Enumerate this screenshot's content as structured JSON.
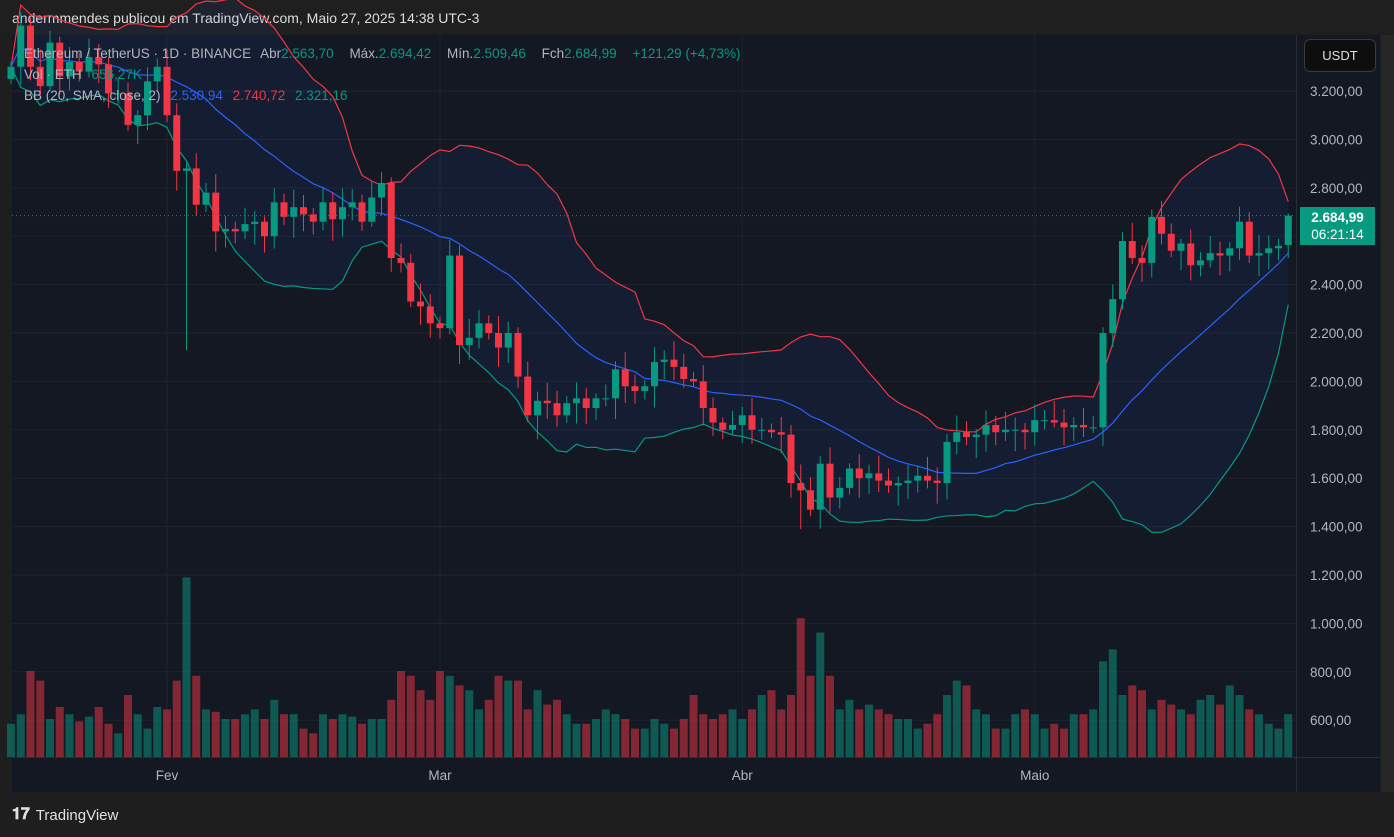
{
  "header": {
    "publisher": "andermmendes publicou em TradingView.com, Maio 27, 2025 14:38 UTC-3"
  },
  "legend": {
    "symbol": "Ethereum / TetherUS · 1D · BINANCE",
    "open_label": "Abr",
    "open": "2.563,70",
    "high_label": "Máx.",
    "high": "2.694,42",
    "low_label": "Mín.",
    "low": "2.509,46",
    "close_label": "Fch",
    "close": "2.684,99",
    "change": "+121,29 (+4,73%)",
    "volume_label": "Vol · ETH",
    "volume": "656,27K",
    "bb_label": "BB (20, SMA, close, 2)",
    "bb_basis": "2.530,94",
    "bb_upper": "2.740,72",
    "bb_lower": "2.321,16"
  },
  "currency": "USDT",
  "last_price": {
    "price": "2.684,99",
    "countdown": "06:21:14"
  },
  "footer": {
    "brand": "TradingView",
    "logo": "17"
  },
  "colors": {
    "up": "#089981",
    "down": "#f23645",
    "basis": "#2962ff",
    "upper": "#f23645",
    "lower": "#089981"
  },
  "chart_data": {
    "type": "candlestick",
    "title": "Ethereum / TetherUS · 1D · BINANCE",
    "start_date": "2025-01-16",
    "end_date": "2025-05-27",
    "first_open": 3250,
    "close": [
      3300,
      3470,
      3300,
      3220,
      3400,
      3260,
      3320,
      3280,
      3340,
      3310,
      3190,
      3190,
      3060,
      3100,
      3240,
      3300,
      3100,
      2870,
      2880,
      2730,
      2780,
      2620,
      2630,
      2620,
      2650,
      2660,
      2600,
      2740,
      2680,
      2720,
      2690,
      2660,
      2740,
      2670,
      2720,
      2740,
      2660,
      2760,
      2820,
      2510,
      2490,
      2330,
      2310,
      2240,
      2220,
      2520,
      2150,
      2180,
      2240,
      2200,
      2140,
      2200,
      2020,
      1860,
      1920,
      1910,
      1860,
      1910,
      1930,
      1890,
      1930,
      1930,
      2050,
      1980,
      1960,
      1980,
      2080,
      2090,
      2060,
      2010,
      2000,
      1890,
      1830,
      1800,
      1820,
      1860,
      1800,
      1800,
      1790,
      1780,
      1580,
      1550,
      1470,
      1660,
      1520,
      1560,
      1640,
      1600,
      1620,
      1590,
      1570,
      1580,
      1590,
      1610,
      1590,
      1580,
      1750,
      1790,
      1770,
      1780,
      1820,
      1790,
      1800,
      1800,
      1790,
      1840,
      1840,
      1830,
      1810,
      1820,
      1810,
      1810,
      2200,
      2340,
      2580,
      2510,
      2490,
      2680,
      2610,
      2540,
      2570,
      2480,
      2500,
      2530,
      2520,
      2550,
      2660,
      2520,
      2530,
      2550,
      2560,
      2684.99
    ],
    "volume": [
      580,
      620,
      800,
      760,
      600,
      650,
      620,
      590,
      610,
      650,
      580,
      540,
      700,
      620,
      560,
      650,
      640,
      760,
      1190,
      780,
      640,
      630,
      600,
      600,
      620,
      640,
      600,
      680,
      620,
      620,
      560,
      540,
      620,
      600,
      620,
      610,
      580,
      600,
      600,
      680,
      800,
      780,
      720,
      680,
      800,
      780,
      740,
      720,
      640,
      680,
      780,
      760,
      760,
      640,
      720,
      660,
      680,
      620,
      580,
      580,
      600,
      640,
      620,
      600,
      560,
      560,
      600,
      580,
      560,
      600,
      700,
      620,
      600,
      620,
      640,
      600,
      640,
      700,
      720,
      640,
      700,
      1020,
      780,
      960,
      780,
      640,
      680,
      640,
      660,
      640,
      620,
      600,
      600,
      560,
      580,
      620,
      700,
      760,
      740,
      640,
      620,
      560,
      560,
      620,
      640,
      620,
      560,
      580,
      560,
      620,
      620,
      640,
      840,
      890,
      700,
      740,
      720,
      640,
      680,
      660,
      640,
      620,
      680,
      700,
      660,
      740,
      700,
      640,
      620,
      580,
      560,
      620
    ],
    "wick_overrides": [
      {
        "date": "2025-02-03",
        "low": 2130
      },
      {
        "date": "2025-03-11",
        "low": 1760
      },
      {
        "date": "2025-04-07",
        "low": 1390
      },
      {
        "date": "2025-05-27",
        "open": 2563.7,
        "high": 2694.42,
        "low": 2509.46
      }
    ],
    "indicator": {
      "name": "BB",
      "length": 20,
      "source": "close",
      "stddev": 2
    },
    "y_ticks": [
      "3.200,00",
      "3.000,00",
      "2.800,00",
      "2.600,00",
      "2.400,00",
      "2.200,00",
      "2.000,00",
      "1.800,00",
      "1.600,00",
      "1.400,00",
      "1.200,00",
      "1.000,00",
      "800,00",
      "600,00"
    ],
    "y_tick_values": [
      3200,
      3000,
      2800,
      2600,
      2400,
      2200,
      2000,
      1800,
      1600,
      1400,
      1200,
      1000,
      800,
      600
    ],
    "x_ticks": [
      {
        "label": "Fev",
        "date": "2025-02-01"
      },
      {
        "label": "Mar",
        "date": "2025-03-01"
      },
      {
        "label": "Abr",
        "date": "2025-04-01"
      },
      {
        "label": "Maio",
        "date": "2025-05-01"
      }
    ],
    "ylim": [
      1200,
      3200
    ]
  }
}
